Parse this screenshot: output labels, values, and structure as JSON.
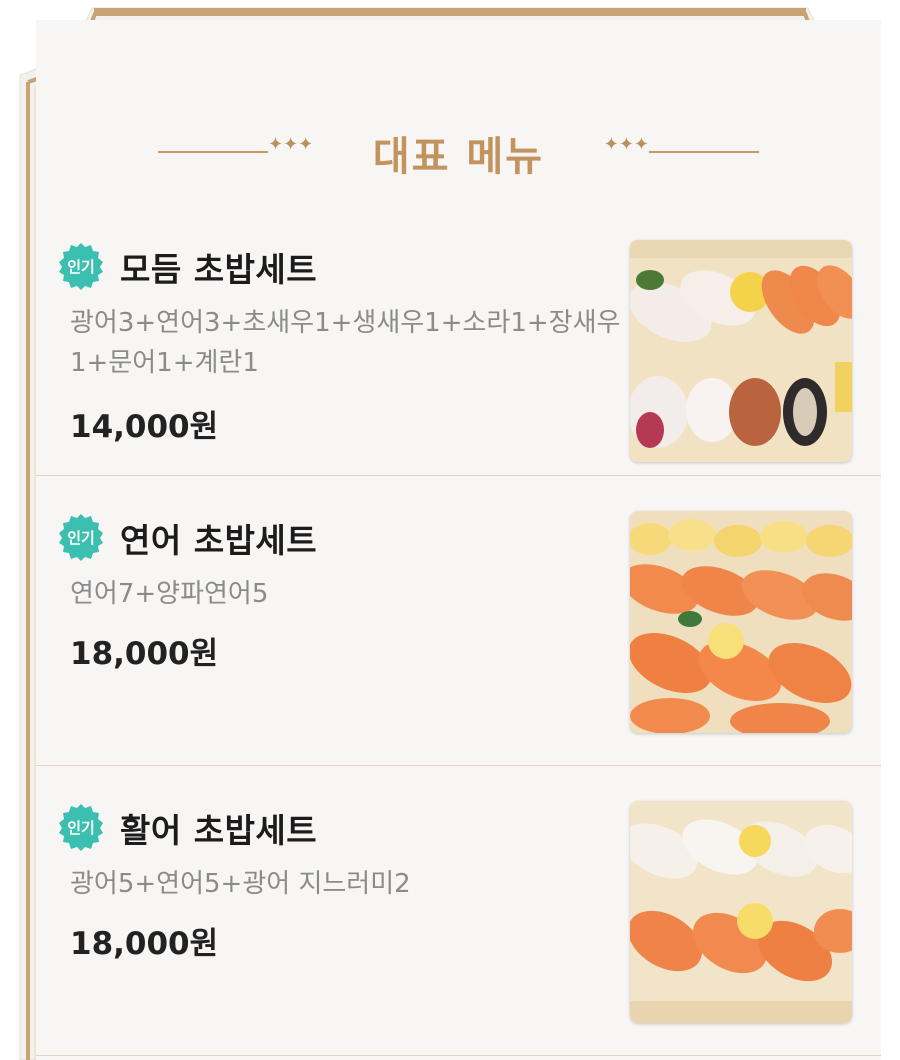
{
  "section": {
    "title": "대표 메뉴",
    "ornament_left": "✦✦✦",
    "ornament_right": "✦✦✦"
  },
  "colors": {
    "accent_gold": "#c2935f",
    "badge_teal": "#3bbfb0",
    "text_dark": "#1c1c1c",
    "text_muted": "#8b8b8b"
  },
  "menu": [
    {
      "badge": "인기",
      "name": "모듬 초밥세트",
      "desc": "광어3+연어3+초새우1+생새우1+소라1+장새우1+문어1+계란1",
      "price": "14,000원",
      "photo": "assorted-sushi-photo"
    },
    {
      "badge": "인기",
      "name": "연어 초밥세트",
      "desc": "연어7+양파연어5",
      "price": "18,000원",
      "photo": "salmon-sushi-photo"
    },
    {
      "badge": "인기",
      "name": "활어 초밥세트",
      "desc": "광어5+연어5+광어 지느러미2",
      "price": "18,000원",
      "photo": "flatfish-salmon-sushi-photo"
    }
  ]
}
